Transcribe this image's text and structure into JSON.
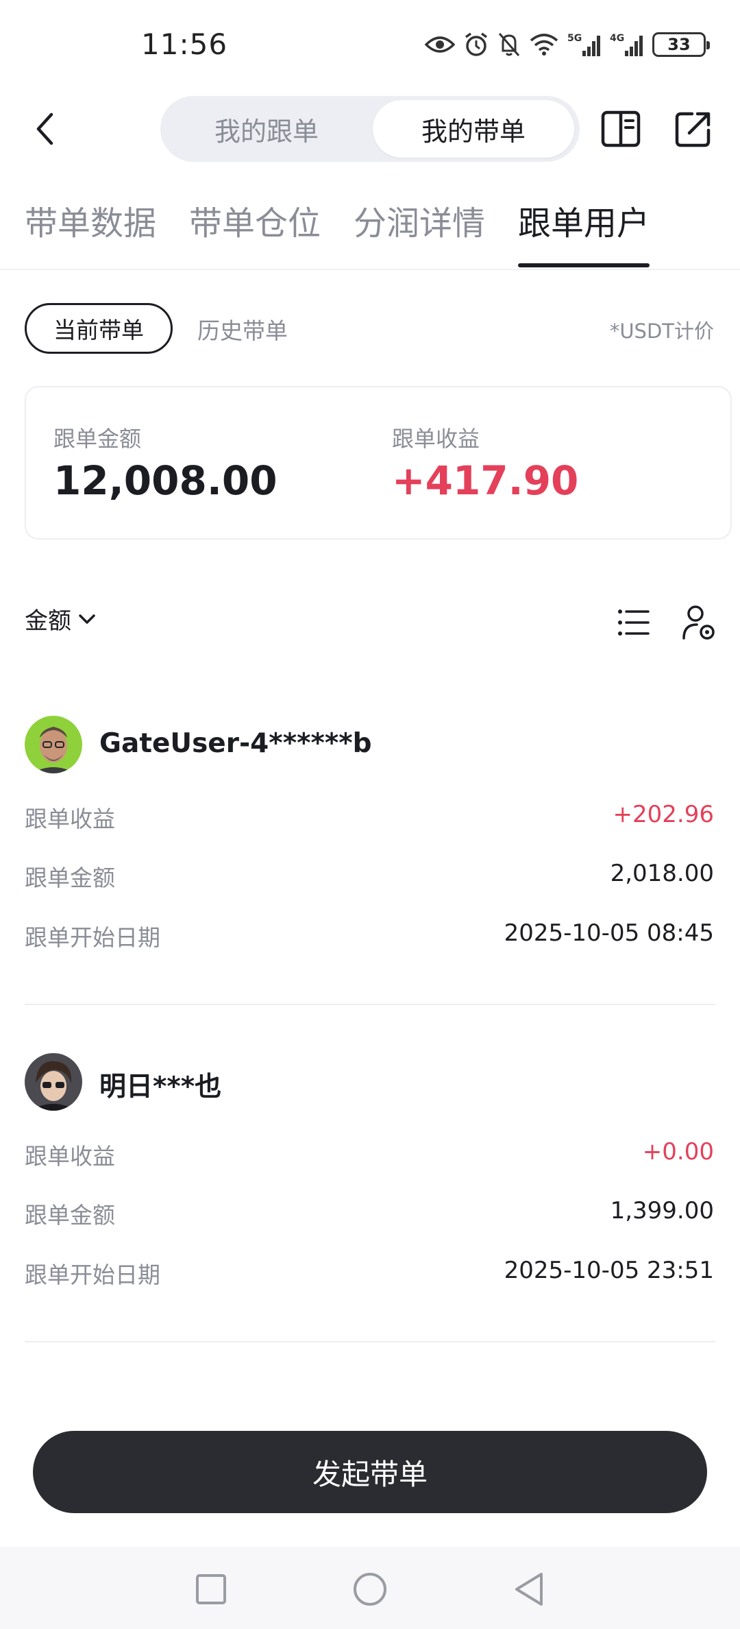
{
  "status_bar": {
    "time": "11:56",
    "battery": "33",
    "icons": [
      "eye-icon",
      "alarm-icon",
      "mute-icon",
      "wifi-icon",
      "signal-5g-icon",
      "signal-4g-icon",
      "battery-icon"
    ]
  },
  "header": {
    "segments": [
      "我的跟单",
      "我的带单"
    ],
    "active_segment": 1,
    "icons": [
      "back-icon",
      "book-icon",
      "share-icon"
    ]
  },
  "tabs": {
    "items": [
      "带单数据",
      "带单仓位",
      "分润详情",
      "跟单用户"
    ],
    "active": 3
  },
  "filter": {
    "current": "当前带单",
    "history": "历史带单",
    "note": "*USDT计价"
  },
  "summary": {
    "amount_label": "跟单金额",
    "amount_value": "12,008.00",
    "profit_label": "跟单收益",
    "profit_value": "+417.90"
  },
  "sort": {
    "label": "金额",
    "icons": [
      "chevron-down-icon",
      "list-icon",
      "user-settings-icon"
    ]
  },
  "followers": [
    {
      "name": "GateUser-4******b",
      "profit_label": "跟单收益",
      "profit": "+202.96",
      "amount_label": "跟单金额",
      "amount": "2,018.00",
      "start_label": "跟单开始日期",
      "start": "2025-10-05 08:45"
    },
    {
      "name": "明日***也",
      "profit_label": "跟单收益",
      "profit": "+0.00",
      "amount_label": "跟单金额",
      "amount": "1,399.00",
      "start_label": "跟单开始日期",
      "start": "2025-10-05 23:51"
    }
  ],
  "action_button": "发起带单",
  "nav": [
    "recent-apps-icon",
    "home-icon",
    "back-nav-icon"
  ],
  "colors": {
    "profit_red": "#e4405a",
    "text_dark": "#1c1d22",
    "text_gray": "#8a8d96",
    "button_dark": "#2b2c31"
  }
}
